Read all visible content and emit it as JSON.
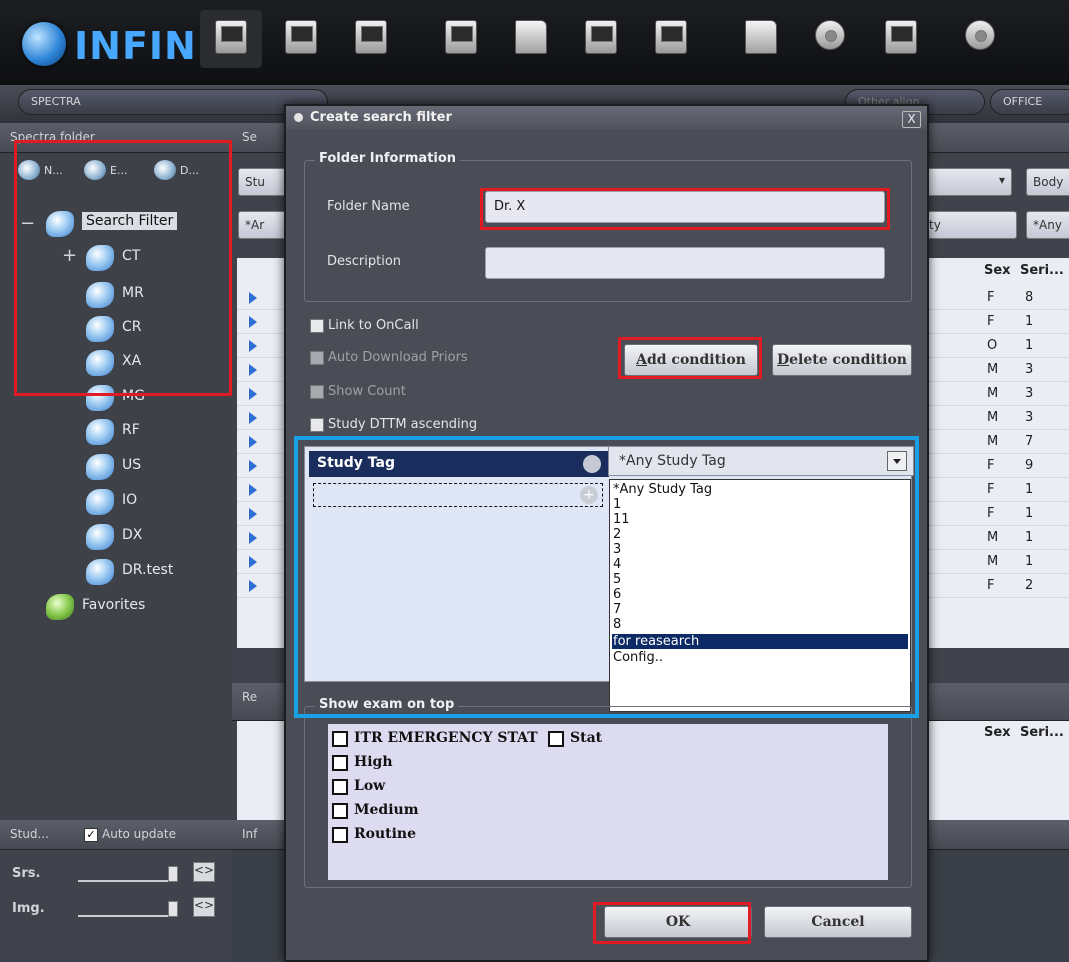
{
  "app": {
    "logo_text": "INFIN",
    "spectra_select": "SPECTRA",
    "other_select": "Other align",
    "office_select": "OFFICE"
  },
  "toolbar": {
    "icons": [
      "monitor-icon",
      "monitor-icon",
      "viewer-icon",
      "worklist-icon",
      "folder-export-icon",
      "archive-icon",
      "database-icon",
      "folder-icon",
      "settings-icon",
      "layout-icon",
      "globe-icon"
    ]
  },
  "left_panel": {
    "title": "Spectra folder",
    "tabs": [
      "N...",
      "E...",
      "D..."
    ],
    "tree": {
      "root": "Search Filter",
      "items": [
        "CT",
        "MR",
        "CR",
        "XA",
        "MG",
        "RF",
        "US",
        "IO",
        "DX",
        "DR.test"
      ],
      "favorites": "Favorites"
    },
    "study_panel": {
      "title": "Stud...",
      "auto_update": "Auto update",
      "srs_label": "Srs.",
      "img_label": "Img."
    }
  },
  "grid": {
    "search_head": "Se",
    "filter_study": "Stu",
    "filter_any": "*Ar",
    "filter_ty": "ty",
    "filter_body": "Body",
    "filter_any2": "*Any",
    "columns": [
      "Sex",
      "Seri..."
    ],
    "rows": [
      {
        "sex": "F",
        "series": "8"
      },
      {
        "sex": "F",
        "series": "1"
      },
      {
        "sex": "O",
        "series": "1"
      },
      {
        "sex": "M",
        "series": "3"
      },
      {
        "sex": "M",
        "series": "3"
      },
      {
        "sex": "M",
        "series": "3"
      },
      {
        "sex": "M",
        "series": "7"
      },
      {
        "sex": "F",
        "series": "9"
      },
      {
        "sex": "F",
        "series": "1"
      },
      {
        "sex": "F",
        "series": "1"
      },
      {
        "sex": "M",
        "series": "1"
      },
      {
        "sex": "M",
        "series": "1"
      },
      {
        "sex": "F",
        "series": "2"
      }
    ],
    "re_head": "Re",
    "re_columns": [
      "Sex",
      "Seri..."
    ],
    "inf_head": "Inf"
  },
  "dialog": {
    "title": "Create search filter",
    "close_label": "X",
    "folder_info": {
      "legend": "Folder Information",
      "name_label": "Folder Name",
      "name_value": "Dr. X",
      "desc_label": "Description",
      "desc_value": ""
    },
    "options": {
      "link_oncall": "Link to OnCall",
      "auto_download": "Auto Download Priors",
      "show_count": "Show Count",
      "study_dttm": "Study DTTM ascending"
    },
    "add_condition": "Add condition",
    "add_condition_key": "A",
    "delete_condition": "Delete condition",
    "delete_condition_key": "D",
    "condition": {
      "tag": "Study Tag",
      "selected": "*Any Study Tag",
      "options": [
        "*Any Study Tag",
        "1",
        "11",
        "2",
        "3",
        "4",
        "5",
        "6",
        "7",
        "8",
        "for reasearch",
        "Config.."
      ],
      "highlighted": "for reasearch"
    },
    "show_exam": {
      "legend": "Show exam on top",
      "items": [
        "ITR EMERGENCY STAT",
        "Stat",
        "High",
        "Low",
        "Medium",
        "Routine"
      ]
    },
    "ok": "OK",
    "cancel": "Cancel"
  },
  "annotation_colors": {
    "red": "#e01b24",
    "blue": "#1aa0e6"
  }
}
